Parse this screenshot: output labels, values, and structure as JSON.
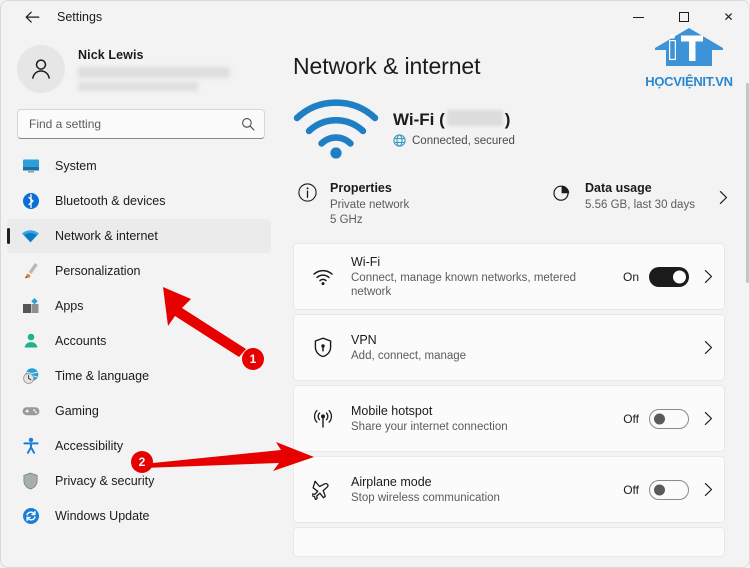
{
  "window": {
    "title": "Settings",
    "back_icon": "back-arrow-icon",
    "minimize_label": "Minimize",
    "maximize_label": "Maximize",
    "close_label": "✕"
  },
  "sidebar": {
    "profile": {
      "name": "Nick Lewis",
      "email_redacted": true
    },
    "search": {
      "placeholder": "Find a setting",
      "value": "",
      "icon": "search-icon"
    },
    "items": [
      {
        "label": "System",
        "icon": "monitor-icon",
        "active": false
      },
      {
        "label": "Bluetooth & devices",
        "icon": "bluetooth-icon",
        "active": false
      },
      {
        "label": "Network & internet",
        "icon": "wifi-icon",
        "active": true
      },
      {
        "label": "Personalization",
        "icon": "paintbrush-icon",
        "active": false
      },
      {
        "label": "Apps",
        "icon": "apps-icon",
        "active": false
      },
      {
        "label": "Accounts",
        "icon": "person-icon",
        "active": false
      },
      {
        "label": "Time & language",
        "icon": "clock-globe-icon",
        "active": false
      },
      {
        "label": "Gaming",
        "icon": "gamepad-icon",
        "active": false
      },
      {
        "label": "Accessibility",
        "icon": "accessibility-icon",
        "active": false
      },
      {
        "label": "Privacy & security",
        "icon": "shield-icon",
        "active": false
      },
      {
        "label": "Windows Update",
        "icon": "update-icon",
        "active": false
      }
    ]
  },
  "main": {
    "page_title": "Network & internet",
    "hero": {
      "prefix": "Wi-Fi (",
      "suffix": ")",
      "ssid_redacted": true,
      "status": "Connected, secured",
      "status_icon": "globe-icon",
      "wifi_icon": "wifi-large-icon",
      "accent_color": "#1f7fc4"
    },
    "info": {
      "properties": {
        "title": "Properties",
        "sub1": "Private network",
        "sub2": "5 GHz",
        "icon": "info-circle-icon"
      },
      "data_usage": {
        "title": "Data usage",
        "sub": "5.56 GB, last 30 days",
        "icon": "pie-chart-icon",
        "chevron": "chevron-right-icon"
      }
    },
    "cards": [
      {
        "title": "Wi-Fi",
        "sub": "Connect, manage known networks, metered network",
        "icon": "wifi-icon",
        "has_toggle": true,
        "toggle_label": "On",
        "toggle_state": "on",
        "chevron": "chevron-right-icon"
      },
      {
        "title": "VPN",
        "sub": "Add, connect, manage",
        "icon": "shield-lock-icon",
        "has_toggle": false,
        "toggle_label": "",
        "toggle_state": "",
        "chevron": "chevron-right-icon"
      },
      {
        "title": "Mobile hotspot",
        "sub": "Share your internet connection",
        "icon": "hotspot-icon",
        "has_toggle": true,
        "toggle_label": "Off",
        "toggle_state": "off",
        "chevron": "chevron-right-icon"
      },
      {
        "title": "Airplane mode",
        "sub": "Stop wireless communication",
        "icon": "airplane-icon",
        "has_toggle": true,
        "toggle_label": "Off",
        "toggle_state": "off",
        "chevron": "chevron-right-icon"
      }
    ]
  },
  "annotations": {
    "color": "#e60000",
    "markers": [
      {
        "number": "1",
        "target": "Network & internet"
      },
      {
        "number": "2",
        "target": "Mobile hotspot"
      }
    ]
  },
  "watermark": {
    "text": "HỌCVIỆNIT.VN",
    "icon": "house-it-logo-icon",
    "color": "#2a87d0"
  }
}
